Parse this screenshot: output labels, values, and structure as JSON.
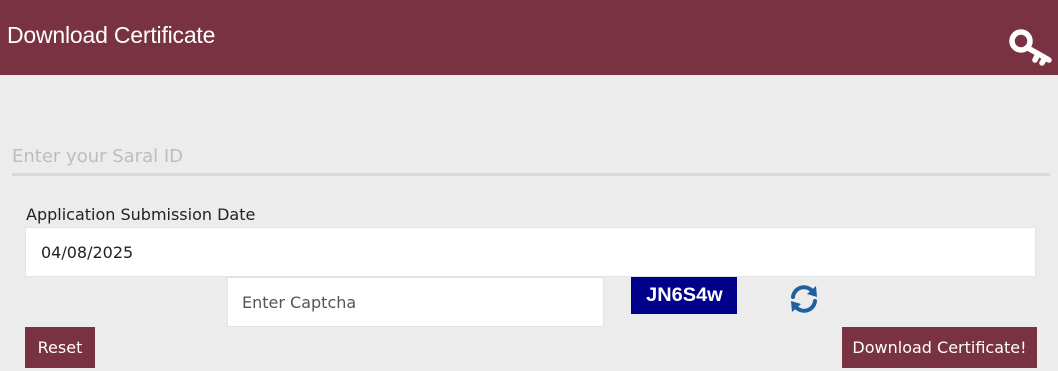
{
  "header": {
    "title": "Download Certificate",
    "icon": "key-icon",
    "background_color": "#783241"
  },
  "form": {
    "saral_id": {
      "placeholder": "Enter your Saral ID",
      "value": ""
    },
    "submission_date": {
      "label": "Application Submission Date",
      "value": "04/08/2025"
    },
    "captcha": {
      "placeholder": "Enter Captcha",
      "value": "",
      "image_text": "JN6S4w",
      "image_background": "#00008b",
      "refresh_icon": "refresh-icon",
      "refresh_color": "#1f5fa0"
    },
    "buttons": {
      "reset_label": "Reset",
      "download_label": "Download Certificate!"
    }
  }
}
